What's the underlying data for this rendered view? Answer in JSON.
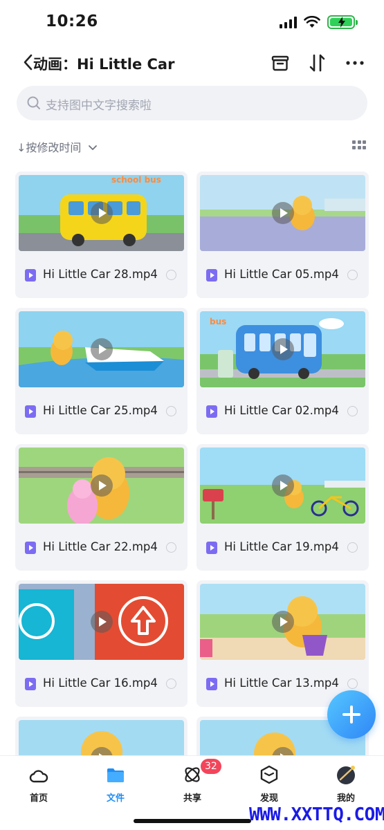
{
  "status_bar": {
    "time": "10:26"
  },
  "header": {
    "title": "动画：Hi Little Car",
    "icons": [
      "chevron-left-icon",
      "archive-icon",
      "sort-icon",
      "more-icon"
    ]
  },
  "search": {
    "placeholder": "支持图中文字搜索啦"
  },
  "sort": {
    "label": "↓按修改时间",
    "icon": "chevron-down-icon"
  },
  "files": [
    {
      "name": "Hi Little Car 28.mp4",
      "thumb_caption": "school bus"
    },
    {
      "name": "Hi Little Car 05.mp4"
    },
    {
      "name": "Hi Little Car 25.mp4"
    },
    {
      "name": "Hi Little Car 02.mp4",
      "thumb_caption": "bus"
    },
    {
      "name": "Hi Little Car 22.mp4"
    },
    {
      "name": "Hi Little Car 19.mp4"
    },
    {
      "name": "Hi Little Car 16.mp4"
    },
    {
      "name": "Hi Little Car 13.mp4"
    }
  ],
  "nav": {
    "items": [
      {
        "label": "首页",
        "icon": "cloud-icon"
      },
      {
        "label": "文件",
        "icon": "folder-icon",
        "active": true
      },
      {
        "label": "共享",
        "icon": "share-icon",
        "badge": "32"
      },
      {
        "label": "发现",
        "icon": "discover-icon"
      },
      {
        "label": "我的",
        "icon": "avatar-icon"
      }
    ]
  },
  "watermark": "WWW.XXTTQ.COM",
  "colors": {
    "accent": "#1e8df5",
    "badge": "#f3455a",
    "file_icon": "#7c6cf2"
  }
}
